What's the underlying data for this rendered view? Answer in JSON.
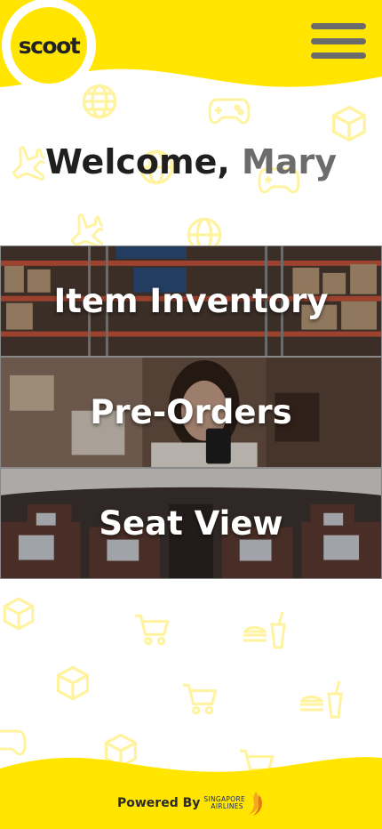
{
  "brand": {
    "logo_text": "scoot",
    "accent_color": "#ffe500",
    "pattern_color": "#fff3a0"
  },
  "header": {
    "menu_icon": "hamburger-menu-icon"
  },
  "welcome": {
    "greeting": "Welcome,",
    "user_name": "Mary"
  },
  "tiles": [
    {
      "label": "Item Inventory",
      "image": "warehouse-shelves-photo"
    },
    {
      "label": "Pre-Orders",
      "image": "woman-using-phone-photo"
    },
    {
      "label": "Seat View",
      "image": "aircraft-cabin-photo"
    }
  ],
  "footer": {
    "powered_by": "Powered By",
    "partner_line1": "SINGAPORE",
    "partner_line2": "AIRLINES"
  }
}
